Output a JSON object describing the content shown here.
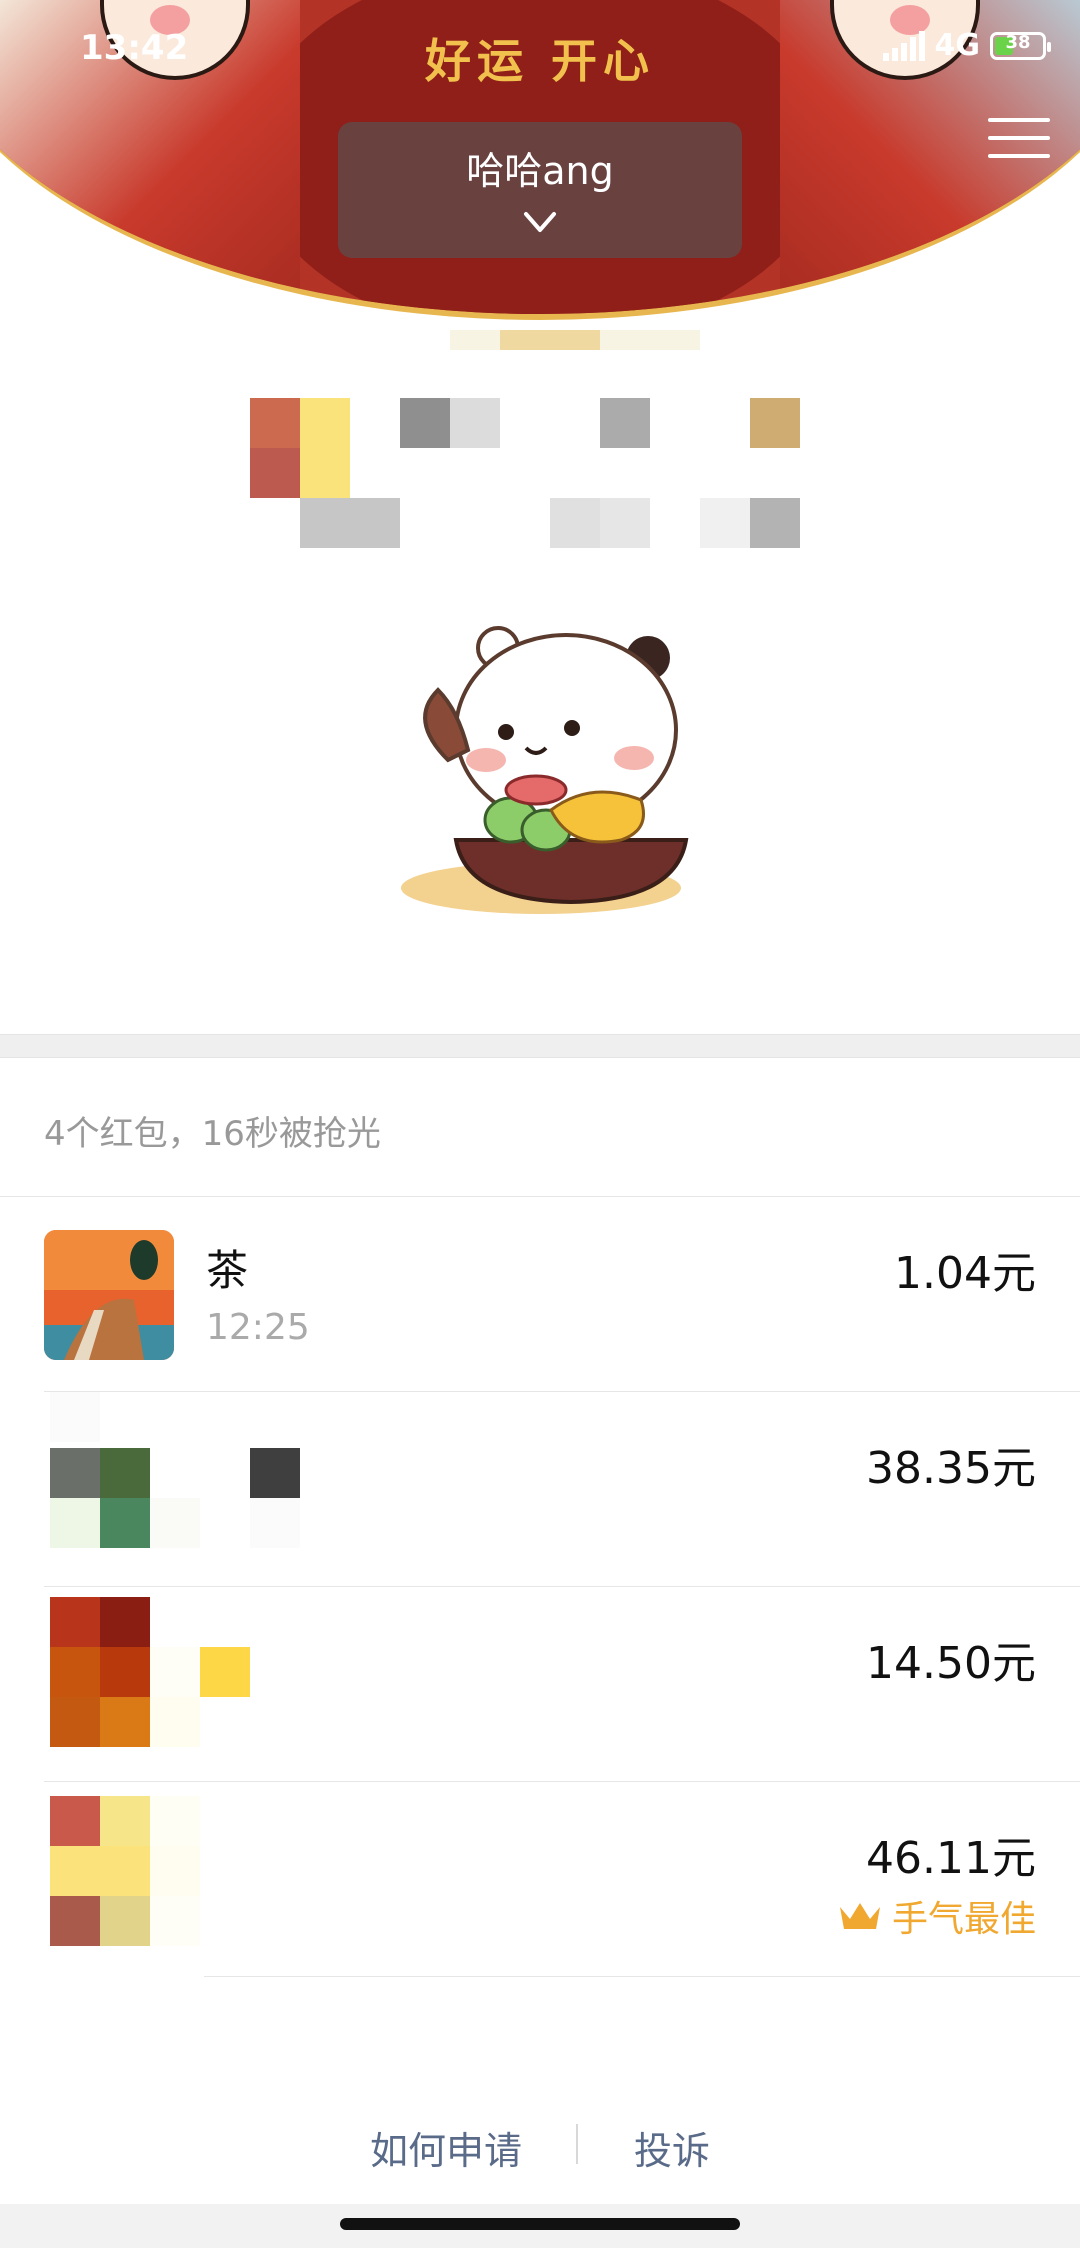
{
  "status_bar": {
    "time": "13:42",
    "network": "4G",
    "battery_percent": "38"
  },
  "header": {
    "blessing": "好运 开心",
    "sender_name": "哈哈ang",
    "icons": [
      "chevron-down-icon",
      "menu-icon"
    ]
  },
  "summary": {
    "text": "4个红包，16秒被抢光"
  },
  "records": [
    {
      "name": "茶",
      "time": "12:25",
      "amount": "1.04元"
    },
    {
      "name": "",
      "time": "",
      "amount": "38.35元"
    },
    {
      "name": "",
      "time": "",
      "amount": "14.50元"
    },
    {
      "name": "",
      "time": "",
      "amount": "46.11元",
      "badge": "手气最佳"
    }
  ],
  "footer": {
    "how_to_apply": "如何申请",
    "complain": "投诉"
  },
  "colors": {
    "red": "#b33427",
    "gold": "#f0a830",
    "link": "#5a6b8a"
  }
}
